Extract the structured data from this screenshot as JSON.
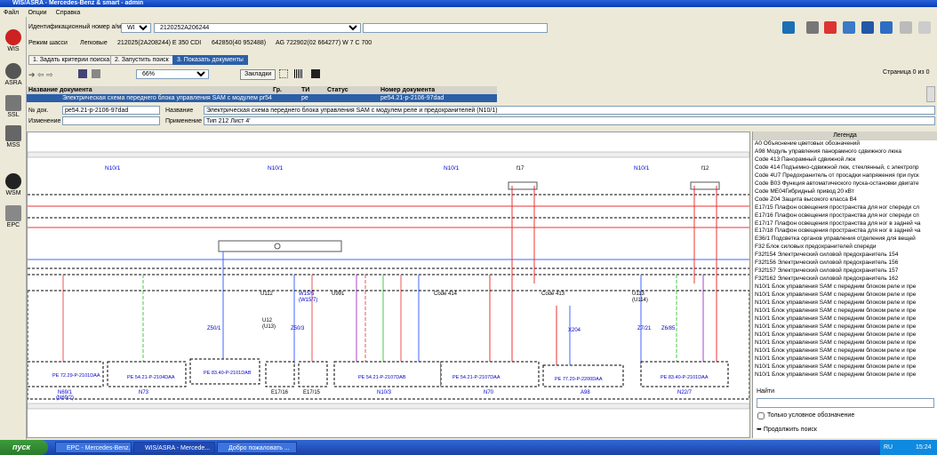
{
  "window": {
    "title": "WIS/ASRA - Mercedes-Benz & smart - admin"
  },
  "menu": [
    "Файл",
    "Опции",
    "Справка"
  ],
  "sidebar": [
    {
      "label": "WIS",
      "icon": "car-icon"
    },
    {
      "label": "ASRA",
      "icon": "steering-icon"
    },
    {
      "label": "SSL",
      "icon": "wrench-icon"
    },
    {
      "label": "MSS",
      "icon": "tools-icon"
    },
    {
      "label": "WSM",
      "icon": "play-icon"
    },
    {
      "label": "EPC",
      "icon": "spark-icon"
    }
  ],
  "vin": {
    "label": "Идентификационный номер а/м",
    "type": "WDD",
    "value": "2120252A206244"
  },
  "chassis": {
    "label": "Режим шасси",
    "type": "Легковые",
    "model": "212025(2A208244) E 350 CDI",
    "engine": "642850(40 952488)",
    "transmission": "AG 722902(02 664277) W 7 C 700"
  },
  "tabs": [
    "1. Задать критерии поиска",
    "2. Запустить поиск",
    "3. Показать документы"
  ],
  "toolbar": {
    "zoom": "66%",
    "bookmarks": "Закладки",
    "page": "Страница 0 из 0"
  },
  "grid": {
    "headers": [
      "Название документа",
      "Гр.",
      "ТИ",
      "Статус",
      "Номер документа"
    ],
    "row": {
      "name": "Электрическая схема переднего блока управления SAM с модулем pr54.21",
      "group": "",
      "ti": "pe",
      "status": "",
      "number": "pe54.21-p-2106-97dad"
    }
  },
  "doc": {
    "no_label": "№ док.",
    "no": "pe54.21-p-2106-97dad",
    "name_label": "Название",
    "name": "Электрическая схема переднего блока управления SAM с модулем реле и предохранителей (N10/1)",
    "change_label": "Изменение",
    "change": "",
    "apply_label": "Применение",
    "apply": "Тип 212 Лист 4'"
  },
  "diagram": {
    "labels": [
      "N10/1",
      "N10/1",
      "N10/1",
      "N10/1",
      "f17",
      "f12",
      "U112",
      "W15/5 (W15/7)",
      "U991",
      "Code 414",
      "Code 413",
      "U113 (U114)",
      "U12 (U13)",
      "Z50/1",
      "Z50/3",
      "X204",
      "Z7/21",
      "Z6/85"
    ],
    "boxes": [
      {
        "label": "N69/1 (N69/2)",
        "ref": "PE 72.29-P-2101DAA"
      },
      {
        "label": "N73",
        "ref": "PE 54.21-P-2104DAA"
      },
      {
        "label": "",
        "ref": "PE 83.40-P-2101DAB"
      },
      {
        "label": "E17/16",
        "ref": ""
      },
      {
        "label": "E17/15",
        "ref": ""
      },
      {
        "label": "N10/3",
        "ref": "PE 54.21-P-2107DAB"
      },
      {
        "label": "N70",
        "ref": "PE 54.21-P-2107DAA"
      },
      {
        "label": "A98",
        "ref": "PE 77.20-P-2200DAA"
      },
      {
        "label": "N22/7",
        "ref": "PE 83.40-P-2101DAA"
      }
    ]
  },
  "legend": {
    "title": "Легенда",
    "items": [
      "A0    Объяснение цветовых обозначений",
      "A98   Модуль управления панорамного сдвижного люка",
      "Code 413 Панорамный сдвижной люк",
      "Code 414 Подъемно-сдвижной люк, стеклянный, с электропр",
      "Code 4U7 Предохранитель от просадки напряжения при пуск",
      "Code B03 Функция автоматического пуска-остановки двигате",
      "Code ME04Гибридный привод 20 кВт",
      "Code Z04 Защита высокого класса В4",
      "E17/15  Плафон освещения пространства для ног спереди сл",
      "E17/16  Плафон освещения пространства для ног спереди сп",
      "E17/17  Плафон освещения пространства для ног в задней ча",
      "E17/18  Плафон освещения пространства для ног в задней ча",
      "E36/1  Подсветка органов управления отделения для вещей",
      "F32    Блок силовых предохранителей спереди",
      "F32f154 Электрический силовой предохранитель 154",
      "F32f156 Электрический силовой предохранитель 156",
      "F32f157 Электрический силовой предохранитель 157",
      "F32f162 Электрический силовой предохранитель 162",
      "N10/1   Блок управления SAM с передним блоком реле и пре",
      "N10/1   Блок управления SAM с передним блоком реле и пре",
      "N10/1   Блок управления SAM с передним блоком реле и пре",
      "N10/1   Блок управления SAM с передним блоком реле и пре",
      "N10/1   Блок управления SAM с передним блоком реле и пре",
      "N10/1   Блок управления SAM с передним блоком реле и пре",
      "N10/1   Блок управления SAM с передним блоком реле и пре",
      "N10/1   Блок управления SAM с передним блоком реле и пре",
      "N10/1   Блок управления SAM с передним блоком реле и пре",
      "N10/1   Блок управления SAM с передним блоком реле и пре",
      "N10/1   Блок управления SAM с передним блоком реле и пре",
      "N10/1   Блок управления SAM с передним блоком реле и пре"
    ],
    "find_label": "Найти",
    "checkbox_label": "Только условное обозначение",
    "continue_label": "Продолжить поиск"
  },
  "taskbar": {
    "start": "пуск",
    "tasks": [
      "EPC - Mercedes-Benz...",
      "WIS/ASRA - Mercede...",
      "Добро пожаловать ..."
    ],
    "lang": "RU",
    "time": "15:24"
  }
}
